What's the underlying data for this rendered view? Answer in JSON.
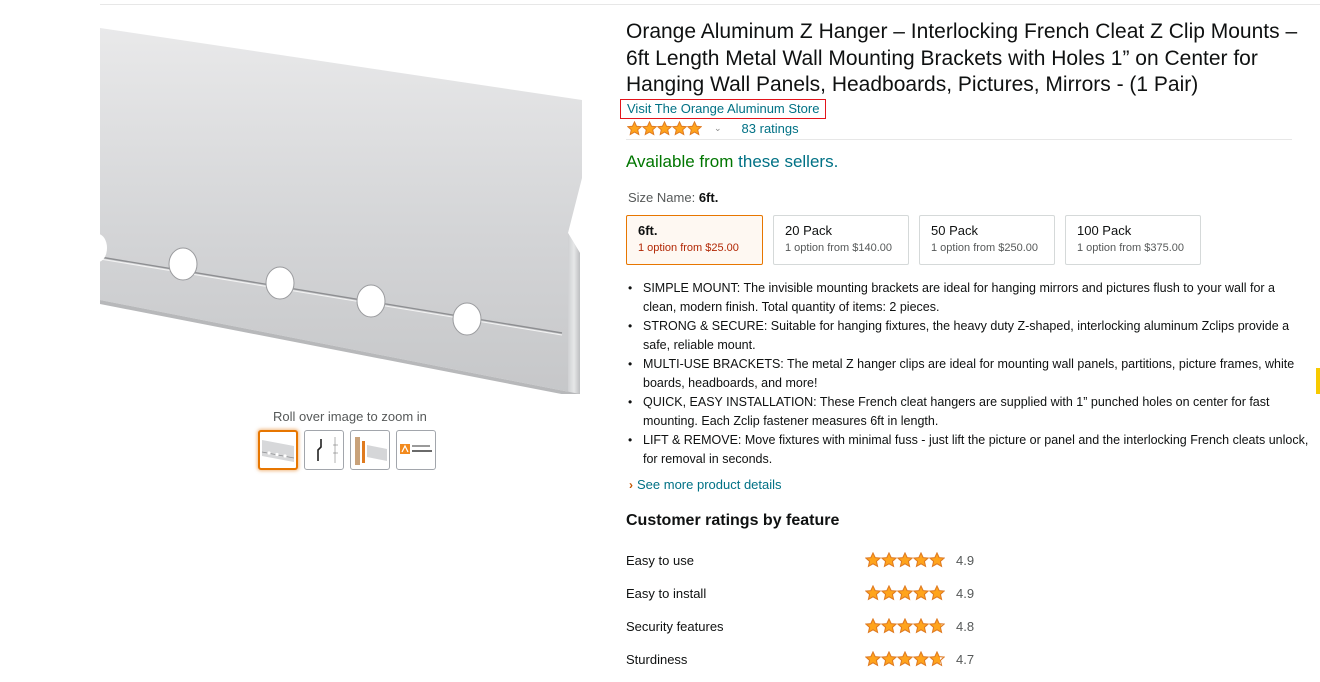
{
  "product": {
    "title": "Orange Aluminum Z Hanger – Interlocking French Cleat Z Clip Mounts – 6ft Length Metal Wall Mounting Brackets with Holes 1” on Center for Hanging Wall Panels, Headboards, Pictures, Mirrors - (1 Pair)",
    "store_link": "Visit The Orange Aluminum Store",
    "rating_value": 5,
    "ratings_count": "83 ratings",
    "availability_prefix": "Available from",
    "availability_link": "these sellers."
  },
  "gallery": {
    "zoom_hint": "Roll over image to zoom in",
    "thumbnails": [
      {
        "name": "thumb-hanger-closeup",
        "selected": true
      },
      {
        "name": "thumb-dimension-diagram",
        "selected": false
      },
      {
        "name": "thumb-mounted-profile",
        "selected": false
      },
      {
        "name": "thumb-brand-logo",
        "selected": false,
        "brand_text": "ORANGE ALUMINUM"
      }
    ]
  },
  "size": {
    "label": "Size Name:",
    "selected": "6ft.",
    "options": [
      {
        "name": "6ft.",
        "price": "1 option from $25.00",
        "selected": true
      },
      {
        "name": "20 Pack",
        "price": "1 option from $140.00",
        "selected": false
      },
      {
        "name": "50 Pack",
        "price": "1 option from $250.00",
        "selected": false
      },
      {
        "name": "100 Pack",
        "price": "1 option from $375.00",
        "selected": false
      }
    ]
  },
  "bullets": [
    "SIMPLE MOUNT: The invisible mounting brackets are ideal for hanging mirrors and pictures flush to your wall for a clean, modern finish. Total quantity of items: 2 pieces.",
    "STRONG & SECURE: Suitable for hanging fixtures, the heavy duty Z-shaped, interlocking aluminum Zclips provide a safe, reliable mount.",
    "MULTI-USE BRACKETS: The metal Z hanger clips are ideal for mounting wall panels, partitions, picture frames, white boards, headboards, and more!",
    "QUICK, EASY INSTALLATION: These French cleat hangers are supplied with 1” punched holes on center for fast mounting. Each Zclip fastener measures 6ft in length.",
    "LIFT & REMOVE: Move fixtures with minimal fuss - just lift the picture or panel and the interlocking French cleats unlock, for removal in seconds."
  ],
  "see_more": "See more product details",
  "features": {
    "heading": "Customer ratings by feature",
    "items": [
      {
        "label": "Easy to use",
        "score": "4.9",
        "stars": 4.9
      },
      {
        "label": "Easy to install",
        "score": "4.9",
        "stars": 4.9
      },
      {
        "label": "Security features",
        "score": "4.8",
        "stars": 4.8
      },
      {
        "label": "Sturdiness",
        "score": "4.7",
        "stars": 4.7
      }
    ]
  },
  "colors": {
    "link": "#007185",
    "available": "#007600",
    "star": "#ffa41c",
    "selected_border": "#e77600",
    "price_selected": "#b12704",
    "store_outline": "#e3141b"
  }
}
